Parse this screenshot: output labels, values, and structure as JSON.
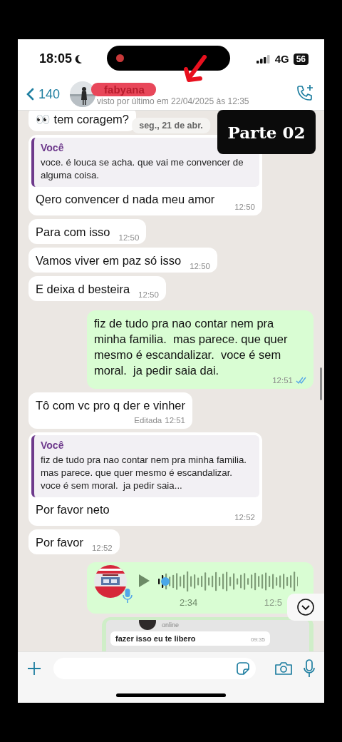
{
  "status_bar": {
    "time": "18:05",
    "network": "4G",
    "battery": "56",
    "recording": true
  },
  "header": {
    "back_count": "140",
    "contact_name": "fabyana",
    "last_seen": "visto por último em 22/04/2025 às 12:35"
  },
  "overlay": {
    "label": "Parte 02"
  },
  "date_chip": "seg., 21 de abr.",
  "messages": [
    {
      "kind": "text",
      "outgoing": false,
      "text": "👀 tem coragem?"
    },
    {
      "kind": "text",
      "outgoing": false,
      "quote": {
        "author": "Você",
        "text": "voce. é louca se acha. que vai me convencer de alguma coisa."
      },
      "text": "Qero convencer d nada meu amor",
      "time": "12:50"
    },
    {
      "kind": "text",
      "outgoing": false,
      "text": "Para com isso",
      "time": "12:50"
    },
    {
      "kind": "text",
      "outgoing": false,
      "text": "Vamos viver em paz só isso",
      "time": "12:50"
    },
    {
      "kind": "text",
      "outgoing": false,
      "text": "E deixa d besteira",
      "time": "12:50"
    },
    {
      "kind": "text",
      "outgoing": true,
      "text": "fiz de tudo pra nao contar nem pra minha familia.  mas parece. que quer mesmo é escandalizar.  voce é sem moral.  ja pedir saia dai.",
      "time": "12:51",
      "read": true
    },
    {
      "kind": "text",
      "outgoing": false,
      "text": "Tô com vc pro q der e vinher",
      "edited": "Editada",
      "time": "12:51"
    },
    {
      "kind": "text",
      "outgoing": false,
      "quote": {
        "author": "Você",
        "text": "fiz de tudo pra nao contar nem pra minha familia.  mas parece. que quer mesmo é escandalizar.  voce é sem moral.  ja pedir saia..."
      },
      "text": "Por favor neto",
      "time": "12:52"
    },
    {
      "kind": "text",
      "outgoing": false,
      "text": "Por favor",
      "time": "12:52"
    },
    {
      "kind": "audio",
      "outgoing": true,
      "duration": "2:34",
      "time": "12:5",
      "level": 0.05
    },
    {
      "kind": "screenshot",
      "outgoing": true,
      "status": "online",
      "text": "fazer isso eu te libero",
      "time": "09:35"
    }
  ]
}
